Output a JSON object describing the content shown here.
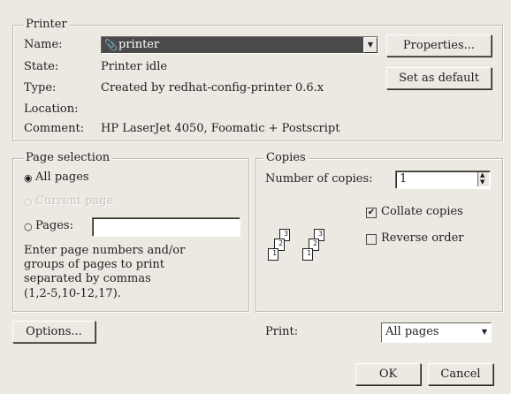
{
  "printer": {
    "title": "Printer",
    "name_label": "Name:",
    "name_value": "printer",
    "state_label": "State:",
    "state_value": "Printer idle",
    "type_label": "Type:",
    "type_value": "Created by redhat-config-printer 0.6.x",
    "location_label": "Location:",
    "location_value": "",
    "comment_label": "Comment:",
    "comment_value": "HP LaserJet 4050, Foomatic + Postscript",
    "properties_button": "Properties...",
    "set_default_button": "Set as default"
  },
  "page_selection": {
    "title": "Page selection",
    "all_pages": "All pages",
    "current_page": "Current page",
    "pages_label": "Pages:",
    "pages_value": "",
    "help_line1": "Enter page numbers and/or",
    "help_line2": "groups of pages to print",
    "help_line3": "separated by commas",
    "help_line4": "(1,2-5,10-12,17).",
    "selected": "All pages"
  },
  "copies": {
    "title": "Copies",
    "number_label": "Number of copies:",
    "number_value": "1",
    "collate_label": "Collate copies",
    "collate_checked": true,
    "reverse_label": "Reverse order",
    "reverse_checked": false
  },
  "bottom": {
    "options_button": "Options...",
    "print_label": "Print:",
    "print_value": "All pages",
    "ok_button": "OK",
    "cancel_button": "Cancel"
  },
  "colors": {
    "background": "#ece9e3",
    "combo_selected": "#4a4a4a"
  }
}
